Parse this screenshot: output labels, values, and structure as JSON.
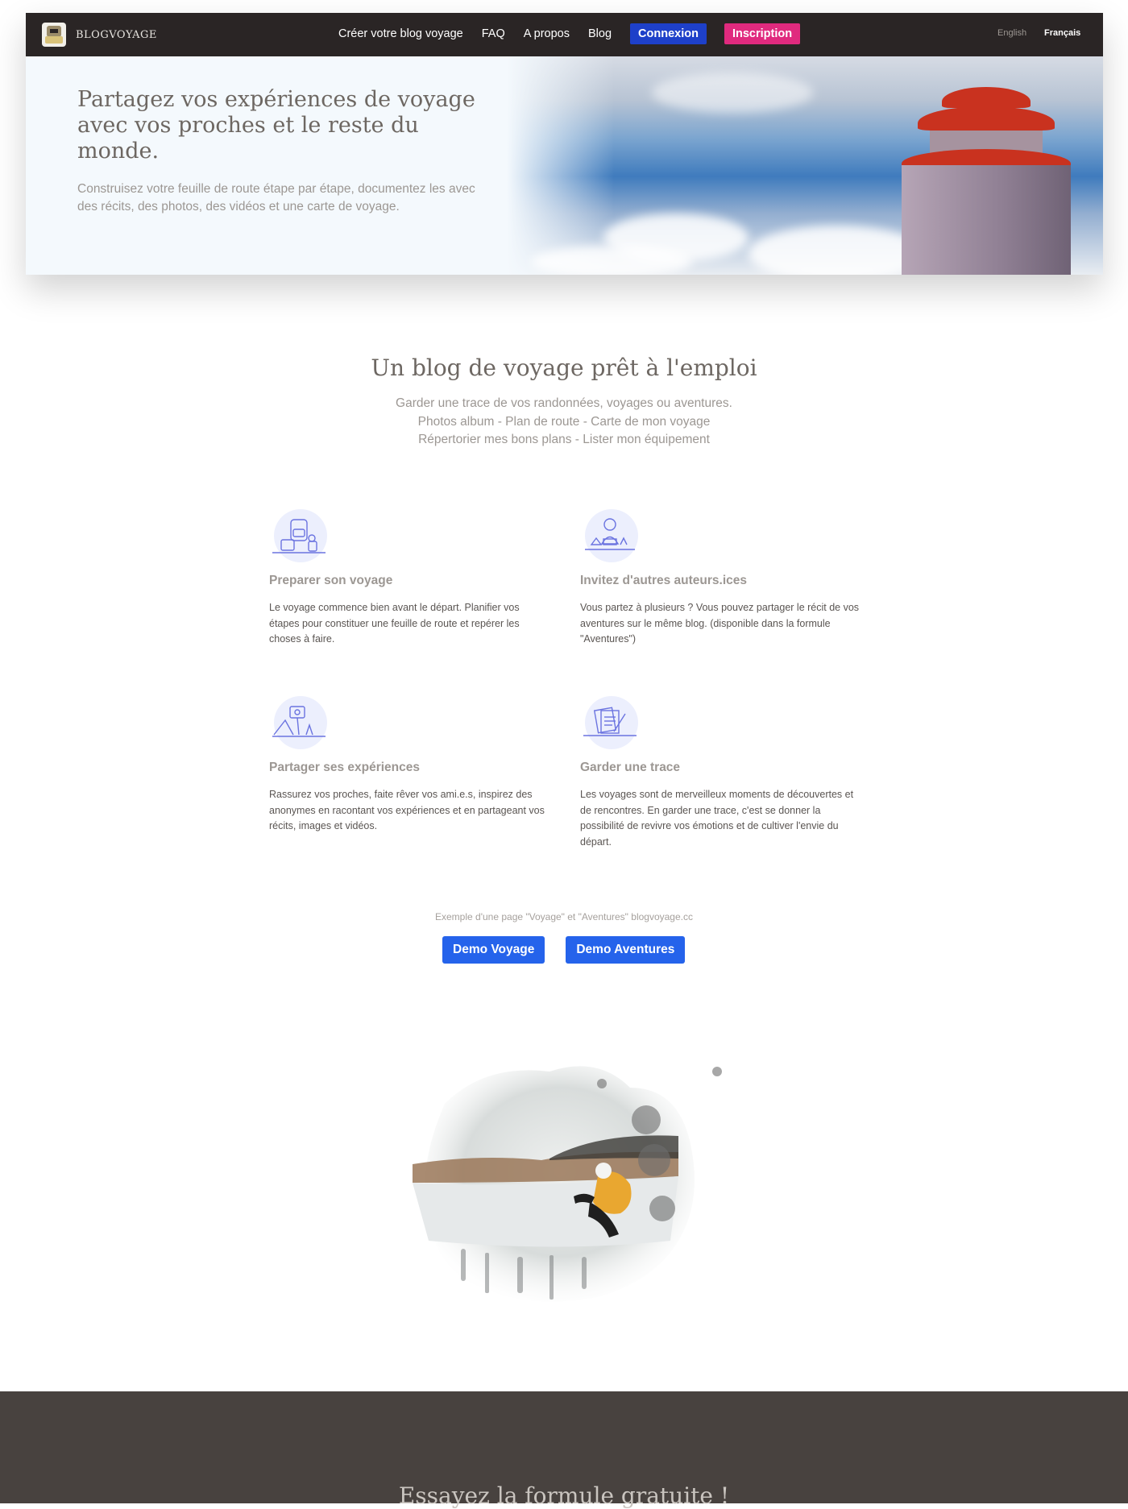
{
  "nav": {
    "brand": "BLOGVOYAGE",
    "links": [
      "Créer votre blog voyage",
      "FAQ",
      "A propos",
      "Blog"
    ],
    "login": "Connexion",
    "signup": "Inscription",
    "lang_en": "English",
    "lang_fr": "Français"
  },
  "hero": {
    "title": "Partagez vos expériences de voyage avec vos proches et le reste du monde.",
    "subtitle": "Construisez votre feuille de route étape par étape, documentez les avec des récits, des photos, des vidéos et une carte de voyage."
  },
  "intro": {
    "title": "Un blog de voyage prêt à l'emploi",
    "line1": "Garder une trace de vos randonnées, voyages ou aventures.",
    "line2": "Photos album - Plan de route - Carte de mon voyage",
    "line3": "Répertorier mes bons plans - Lister mon équipement"
  },
  "features": [
    {
      "icon": "backpack-icon",
      "title": "Preparer son voyage",
      "text": "Le voyage commence bien avant le départ. Planifier vos étapes pour constituer une feuille de route et repérer les choses à faire."
    },
    {
      "icon": "author-icon",
      "title": "Invitez d'autres auteurs.ices",
      "text": "Vous partez à plusieurs ? Vous pouvez partager le récit de vos aventures sur le même blog. (disponible dans la formule \"Aventures\")"
    },
    {
      "icon": "selfie-icon",
      "title": "Partager ses expériences",
      "text": "Rassurez vos proches, faite rêver vos ami.e.s, inspirez des anonymes en racontant vos expériences et en partageant vos récits, images et vidéos."
    },
    {
      "icon": "journal-icon",
      "title": "Garder une trace",
      "text": "Les voyages sont de merveilleux moments de découvertes et de rencontres. En garder une trace, c'est se donner la possibilité de revivre vos émotions et de cultiver l'envie du départ."
    }
  ],
  "demo": {
    "caption": "Exemple d'une page \"Voyage\" et \"Aventures\" blogvoyage.cc",
    "btn_voyage": "Demo Voyage",
    "btn_aventures": "Demo Aventures"
  },
  "footer": {
    "title": "Essayez la formule gratuite !"
  },
  "colors": {
    "nav_bg": "#2a2525",
    "login_bg": "#1e40c9",
    "signup_bg": "#e02a7e",
    "demo_btn_bg": "#2563eb",
    "footer_bg": "#48423f"
  }
}
